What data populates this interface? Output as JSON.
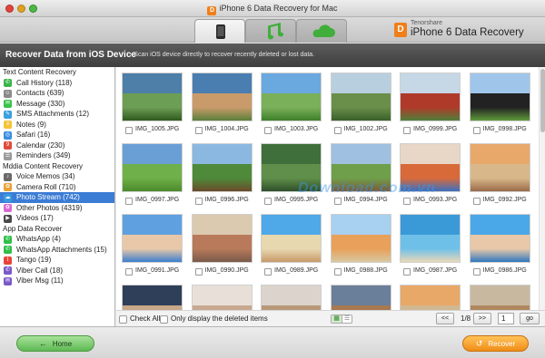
{
  "window": {
    "title": "iPhone 6 Data Recovery for Mac",
    "logo_letter": "D"
  },
  "brand": {
    "vendor": "Tenorshare",
    "product": "iPhone 6 Data Recovery",
    "logo_letter": "D"
  },
  "tabs": [
    {
      "name": "device",
      "icon": "iphone-icon",
      "active": true,
      "glyph": "▯"
    },
    {
      "name": "music",
      "icon": "music-note-icon",
      "active": false,
      "glyph": "♫"
    },
    {
      "name": "cloud",
      "icon": "cloud-icon",
      "active": false,
      "glyph": "☁"
    }
  ],
  "banner": {
    "title": "Recover Data from iOS Device",
    "description": "- Scan iOS device directly to recover recently deleted or lost data."
  },
  "sidebar": {
    "sections": [
      {
        "title": "Text Content Recovery",
        "items": [
          {
            "label": "Call History (118)",
            "icon": "phone-icon",
            "color": "#3bb54a",
            "glyph": "✆"
          },
          {
            "label": "Contacts (639)",
            "icon": "contacts-icon",
            "color": "#8a8a8a",
            "glyph": "☺"
          },
          {
            "label": "Message (330)",
            "icon": "message-icon",
            "color": "#39c24a",
            "glyph": "✉"
          },
          {
            "label": "SMS Attachments (12)",
            "icon": "attachment-icon",
            "color": "#3aa0e0",
            "glyph": "✎"
          },
          {
            "label": "Notes (9)",
            "icon": "notes-icon",
            "color": "#f3c33a",
            "glyph": "≡"
          },
          {
            "label": "Safari (16)",
            "icon": "safari-icon",
            "color": "#3a8ee0",
            "glyph": "◎"
          },
          {
            "label": "Calendar (230)",
            "icon": "calendar-icon",
            "color": "#e04a3a",
            "glyph": "9"
          },
          {
            "label": "Reminders (349)",
            "icon": "reminders-icon",
            "color": "#9a9a9a",
            "glyph": "☰"
          }
        ]
      },
      {
        "title": "Mddia Content Recovery",
        "items": [
          {
            "label": "Voice Memos (34)",
            "icon": "voice-memo-icon",
            "color": "#6a6a6a",
            "glyph": "♪"
          },
          {
            "label": "Camera Roll (710)",
            "icon": "camera-roll-icon",
            "color": "#e8a23a",
            "glyph": "✿"
          },
          {
            "label": "Photo Stream (742)",
            "icon": "photo-stream-icon",
            "color": "#3a9ae0",
            "glyph": "☁"
          },
          {
            "label": "Other Photos (4319)",
            "icon": "photos-icon",
            "color": "#d86ad0",
            "glyph": "✿"
          },
          {
            "label": "Videos (17)",
            "icon": "video-icon",
            "color": "#4a4a4a",
            "glyph": "▶"
          }
        ]
      },
      {
        "title": "App Data Recover",
        "items": [
          {
            "label": "WhatsApp (4)",
            "icon": "whatsapp-icon",
            "color": "#2fbf48",
            "glyph": "✆"
          },
          {
            "label": "WhatsApp Attachments (15)",
            "icon": "whatsapp-attachment-icon",
            "color": "#2fbf48",
            "glyph": "✆"
          },
          {
            "label": "Tango (19)",
            "icon": "tango-icon",
            "color": "#e8453a",
            "glyph": "t"
          },
          {
            "label": "Viber Call (18)",
            "icon": "viber-icon",
            "color": "#7a58c8",
            "glyph": "✆"
          },
          {
            "label": "Viber Msg (11)",
            "icon": "viber-msg-icon",
            "color": "#7a58c8",
            "glyph": "✉"
          }
        ]
      }
    ],
    "selected": "Photo Stream (742)"
  },
  "photos": [
    {
      "name": "IMG_1005.JPG",
      "colors": [
        "#4d7fa8",
        "#6d9e55",
        "#2f5a1f"
      ]
    },
    {
      "name": "IMG_1004.JPG",
      "colors": [
        "#4a7db0",
        "#c99b6a",
        "#5a7f3a"
      ]
    },
    {
      "name": "IMG_1003.JPG",
      "colors": [
        "#6aa8e0",
        "#7ab05a",
        "#3f7f2a"
      ]
    },
    {
      "name": "IMG_1002.JPG",
      "colors": [
        "#b8cfe0",
        "#6a8f4a",
        "#3a5f2a"
      ]
    },
    {
      "name": "IMG_0999.JPG",
      "colors": [
        "#c6d7e6",
        "#b03a2a",
        "#4f7f3a"
      ]
    },
    {
      "name": "IMG_0998.JPG",
      "colors": [
        "#9fc6ea",
        "#222222",
        "#5f9a3a"
      ]
    },
    {
      "name": "IMG_0997.JPG",
      "colors": [
        "#6a9fd6",
        "#6fb04a",
        "#4a8a2a"
      ]
    },
    {
      "name": "IMG_0996.JPG",
      "colors": [
        "#8ab8e0",
        "#4e8a3a",
        "#6a4a2a"
      ]
    },
    {
      "name": "IMG_0995.JPG",
      "colors": [
        "#3f6f3a",
        "#5f8f4a",
        "#2f4f2a"
      ]
    },
    {
      "name": "IMG_0994.JPG",
      "colors": [
        "#9fc0e0",
        "#6f9f4a",
        "#7a5a3a"
      ]
    },
    {
      "name": "IMG_0993.JPG",
      "colors": [
        "#e8d6c6",
        "#d86a3a",
        "#3a6fc0"
      ]
    },
    {
      "name": "IMG_0992.JPG",
      "colors": [
        "#e8a86a",
        "#d8b88a",
        "#9a6a4a"
      ]
    },
    {
      "name": "IMG_0991.JPG",
      "colors": [
        "#5fa0e0",
        "#e8c8a8",
        "#3a7fd0"
      ]
    },
    {
      "name": "IMG_0990.JPG",
      "colors": [
        "#dccab0",
        "#b87a5a",
        "#7a5a4a"
      ]
    },
    {
      "name": "IMG_0989.JPG",
      "colors": [
        "#4fa8e8",
        "#e8d8b0",
        "#c89a6a"
      ]
    },
    {
      "name": "IMG_0988.JPG",
      "colors": [
        "#a8d0f0",
        "#e8a05a",
        "#d8c8a0"
      ]
    },
    {
      "name": "IMG_0987.JPG",
      "colors": [
        "#3a9ad8",
        "#6fc0e8",
        "#e8d8b8"
      ]
    },
    {
      "name": "IMG_0986.JPG",
      "colors": [
        "#4aa8e8",
        "#e8c8a8",
        "#2f78c0"
      ]
    },
    {
      "name": "",
      "colors": [
        "#2f3f5a",
        "#c8a888",
        "#8a6a5a"
      ]
    },
    {
      "name": "",
      "colors": [
        "#e8e0d8",
        "#c8a890",
        "#9a8070"
      ]
    },
    {
      "name": "",
      "colors": [
        "#dcd4cc",
        "#b89878",
        "#7a6858"
      ]
    },
    {
      "name": "",
      "colors": [
        "#6a7f9a",
        "#a87850",
        "#5a4030"
      ]
    },
    {
      "name": "",
      "colors": [
        "#e8a868",
        "#d0b890",
        "#8a6a4a"
      ]
    },
    {
      "name": "",
      "colors": [
        "#c8b8a0",
        "#b08860",
        "#7a5a3a"
      ]
    }
  ],
  "watermark": "Download.com.vn",
  "bottom_bar": {
    "check_all": "Check All",
    "only_deleted": "Only display the deleted items",
    "prev_label": "<<",
    "next_label": ">>",
    "page_count": "1/8",
    "page_value": "1",
    "go_label": "go"
  },
  "footer": {
    "home_label": "Home",
    "recover_label": "Recover",
    "home_icon_glyph": "←",
    "recover_icon_glyph": "↺"
  }
}
